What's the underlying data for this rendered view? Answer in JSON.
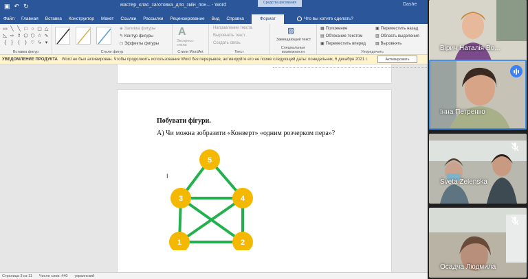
{
  "word": {
    "title": "мастер_клас_заготовка_для_змін_пон... - Word",
    "context_label": "Средства рисования",
    "user": "Dashe",
    "tabs": [
      {
        "label": "Файл"
      },
      {
        "label": "Главная"
      },
      {
        "label": "Вставка"
      },
      {
        "label": "Конструктор"
      },
      {
        "label": "Макет"
      },
      {
        "label": "Ссылки"
      },
      {
        "label": "Рассылки"
      },
      {
        "label": "Рецензирование"
      },
      {
        "label": "Вид"
      },
      {
        "label": "Справка"
      },
      {
        "label": "Формат"
      }
    ],
    "tell_me": "Что вы хотите сделать?",
    "ribbon": {
      "insert_shapes_label": "Вставка фигур",
      "shape_styles_label": "Стили фигур",
      "fill": "Заливка фигуры",
      "outline": "Контур фигуры",
      "effects": "Эффекты фигуры",
      "wordart_label": "Стили WordArt",
      "express_styles": "Экспресс-стили",
      "text_direction": "Направление текста",
      "align_text": "Выровнять текст",
      "create_link": "Создать связь",
      "text_label": "Текст",
      "alt_text": "Замещающий текст",
      "accessibility_label": "Специальные возможности",
      "position": "Положение",
      "wrap_text": "Обтекание текстом",
      "bring_forward": "Переместить вперед",
      "send_backward": "Переместить назад",
      "selection_pane": "Область выделения",
      "align": "Выровнять",
      "arrange_label": "Упорядочить"
    },
    "notification": {
      "heading": "УВЕДОМЛЕНИЕ ПРОДУКТА",
      "text": "Word не был активирован. Чтобы продолжить использование Word без перерывов, активируйте его не позже следующей даты: понедельник, 6 декабря 2021 г.",
      "button": "Активировать"
    },
    "document": {
      "title": "Побувати фігури.",
      "question": "А) Чи можна зобразити «Конверт» «одним розчерком пера»?",
      "graph": {
        "nodes": [
          {
            "id": "5",
            "label": "5"
          },
          {
            "id": "3",
            "label": "3"
          },
          {
            "id": "4",
            "label": "4"
          },
          {
            "id": "1",
            "label": "1"
          },
          {
            "id": "2",
            "label": "2"
          }
        ],
        "edges": [
          [
            "5",
            "3"
          ],
          [
            "5",
            "4"
          ],
          [
            "3",
            "4"
          ],
          [
            "3",
            "1"
          ],
          [
            "3",
            "2"
          ],
          [
            "4",
            "1"
          ],
          [
            "4",
            "2"
          ],
          [
            "1",
            "2"
          ]
        ],
        "node_color": "#f5b800",
        "edge_color": "#22b14c"
      }
    },
    "status": {
      "page": "Страница 3 из 11",
      "words": "Число слов: 440",
      "language": "украинский"
    }
  },
  "participants": [
    {
      "name": "Вірич Наталія Во...",
      "state": "normal"
    },
    {
      "name": "Інна Петренко",
      "state": "speaking"
    },
    {
      "name": "Sveta Zelenska",
      "state": "muted"
    },
    {
      "name": "Осадча Людмила",
      "state": "muted"
    }
  ],
  "colors": {
    "word_blue": "#2b579a",
    "active_speaker": "#4a90e2"
  }
}
